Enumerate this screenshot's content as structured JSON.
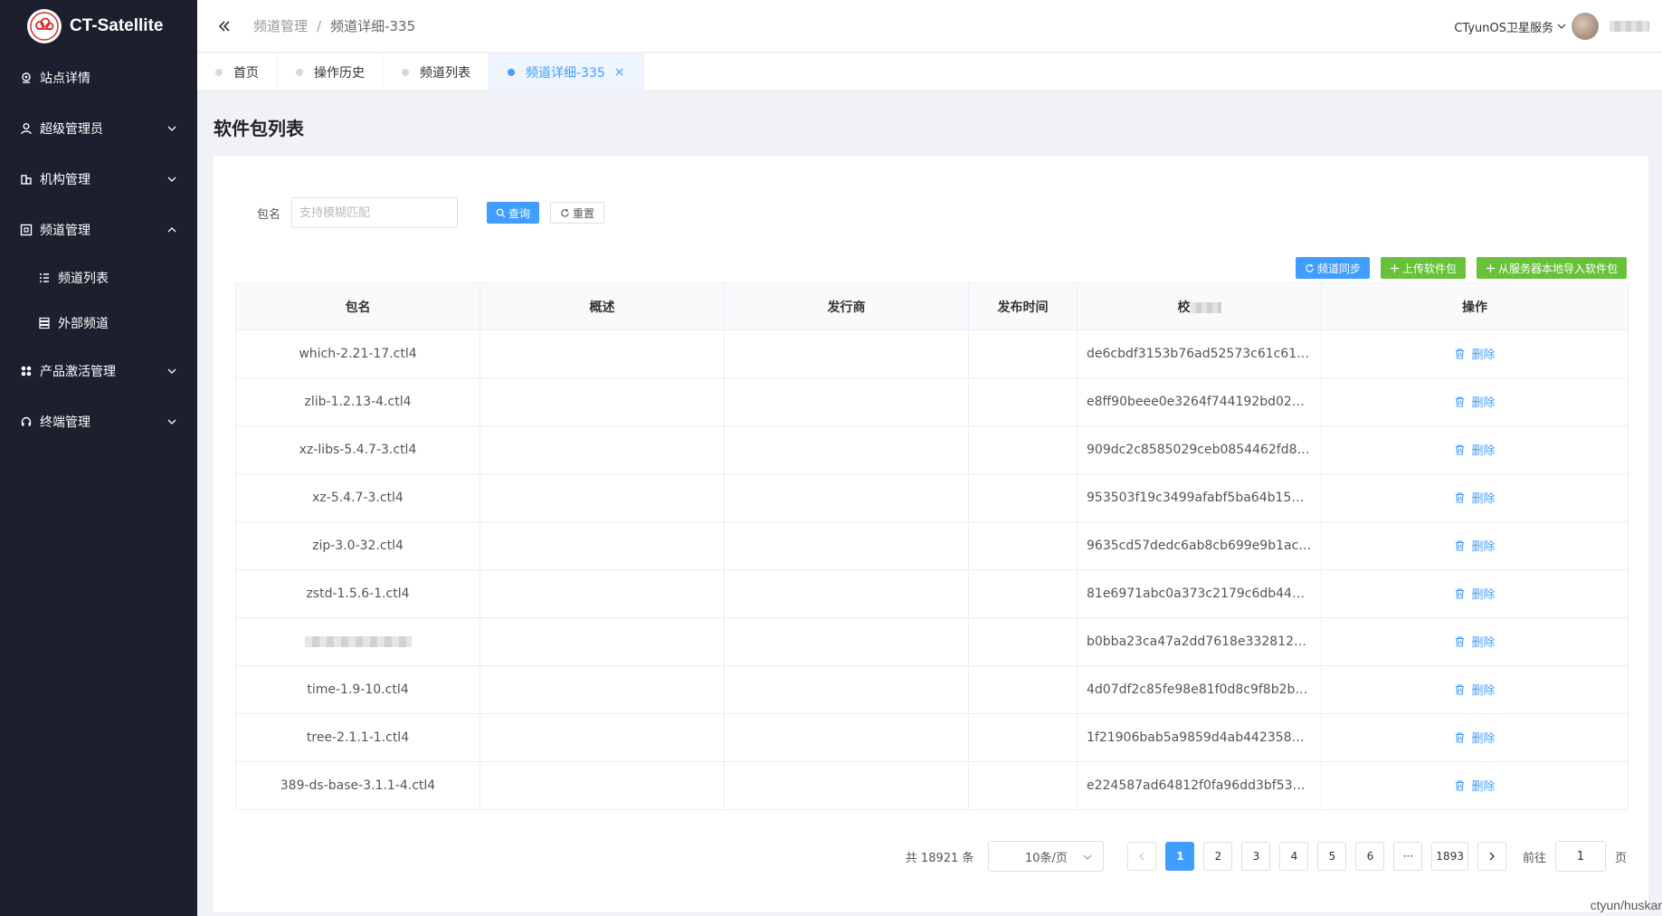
{
  "app": {
    "name": "CT-Satellite"
  },
  "sidebar": {
    "items": [
      {
        "label": "站点详情"
      },
      {
        "label": "超级管理员"
      },
      {
        "label": "机构管理"
      },
      {
        "label": "频道管理"
      },
      {
        "label": "产品激活管理"
      },
      {
        "label": "终端管理"
      }
    ],
    "subitems": [
      {
        "label": "频道列表"
      },
      {
        "label": "外部频道"
      }
    ]
  },
  "header": {
    "breadcrumb": [
      "频道管理",
      "频道详细-335"
    ],
    "separator": "/",
    "user_name": "CTyunOS卫星服务"
  },
  "tabs": [
    {
      "label": "首页"
    },
    {
      "label": "操作历史"
    },
    {
      "label": "频道列表"
    },
    {
      "label": "频道详细-335",
      "close": "×"
    }
  ],
  "page": {
    "title": "软件包列表"
  },
  "search": {
    "label": "包名",
    "placeholder": "支持模糊匹配",
    "query_label": "查询",
    "reset_label": "重置"
  },
  "toolbar": {
    "sync_label": "频道同步",
    "upload_label": "上传软件包",
    "import_label": "从服务器本地导入软件包"
  },
  "table": {
    "headers": [
      "包名",
      "概述",
      "发行商",
      "发布时间",
      "校",
      "操作"
    ],
    "delete_label": "删除",
    "rows": [
      {
        "name": "which-2.21-17.ctl4",
        "checksum": "de6cbdf3153b76ad52573c61c611d0…"
      },
      {
        "name": "zlib-1.2.13-4.ctl4",
        "checksum": "e8ff90beee0e3264f744192bd025e28…"
      },
      {
        "name": "xz-libs-5.4.7-3.ctl4",
        "checksum": "909dc2c8585029ceb0854462fd8622…"
      },
      {
        "name": "xz-5.4.7-3.ctl4",
        "checksum": "953503f19c3499afabf5ba64b155344…"
      },
      {
        "name": "zip-3.0-32.ctl4",
        "checksum": "9635cd57dedc6ab8cb699e9b1ac33c…"
      },
      {
        "name": "zstd-1.5.6-1.ctl4",
        "checksum": "81e6971abc0a373c2179c6db44b8d…"
      },
      {
        "name": "",
        "checksum": "b0bba23ca47a2dd7618e3328128bb…"
      },
      {
        "name": "time-1.9-10.ctl4",
        "checksum": "4d07df2c85fe98e81f0d8c9f8b2bbf8f…"
      },
      {
        "name": "tree-2.1.1-1.ctl4",
        "checksum": "1f21906bab5a9859d4ab44235827cf…"
      },
      {
        "name": "389-ds-base-3.1.1-4.ctl4",
        "checksum": "e224587ad64812f0fa96dd3bf5326d5…"
      }
    ]
  },
  "pagination": {
    "total": "共 18921 条",
    "page_size": "10条/页",
    "pages": [
      "1",
      "2",
      "3",
      "4",
      "5",
      "6",
      "···",
      "1893"
    ],
    "current": "1",
    "goto_label": "前往",
    "goto_value": "1",
    "page_suffix": "页"
  },
  "watermark": "ctyun/huskar",
  "colors": {
    "primary": "#409eff",
    "success": "#67c23a",
    "sidebar_bg": "#1b1f2e"
  }
}
